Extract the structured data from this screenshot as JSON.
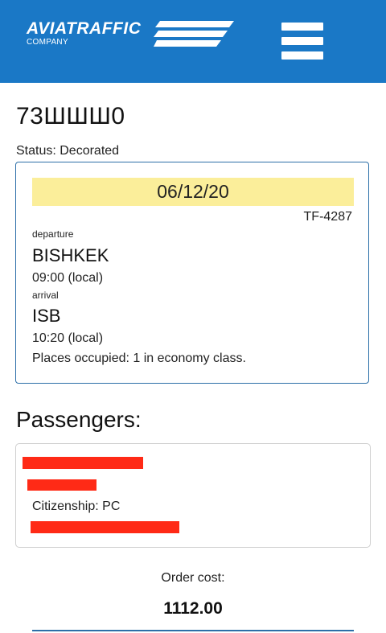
{
  "header": {
    "logo_main": "AVIATRAFFIC",
    "logo_sub": "COMPANY",
    "menu_icon": "hamburger-menu-icon",
    "brand_color": "#1a78c6"
  },
  "order": {
    "id": "73ШШШ0",
    "status": "Status: Decorated"
  },
  "flight": {
    "date": "06/12/20",
    "number": "TF-4287",
    "departure_label": "departure",
    "departure_city": "BISHKEK",
    "departure_time": "09:00 (local)",
    "arrival_label": "arrival",
    "arrival_city": "ISB",
    "arrival_time": "10:20 (local)",
    "places": "Places occupied: 1 in economy class.",
    "date_highlight_color": "#fbee9a"
  },
  "passengers": {
    "title": "Passengers:",
    "items": [
      {
        "citizenship": "Citizenship: PC"
      }
    ]
  },
  "order_cost": {
    "label": "Order cost:",
    "value": "1112.00"
  }
}
